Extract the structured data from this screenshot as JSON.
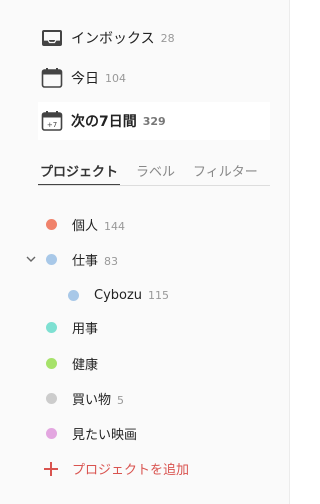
{
  "filters": [
    {
      "label": "インボックス",
      "count": "28",
      "icon": "inbox-icon"
    },
    {
      "label": "今日",
      "count": "104",
      "icon": "calendar-today-icon"
    },
    {
      "label": "次の7日間",
      "count": "329",
      "icon": "calendar-week-icon",
      "icon_text": "+7"
    }
  ],
  "tabs": [
    "プロジェクト",
    "ラベル",
    "フィルター"
  ],
  "projects": [
    {
      "name": "個人",
      "count": "144",
      "color": "#f0826b"
    },
    {
      "name": "仕事",
      "count": "83",
      "color": "#a8c8e8",
      "expanded": true
    },
    {
      "name": "Cybozu",
      "count": "115",
      "color": "#a8c8e8",
      "child": true
    },
    {
      "name": "用事",
      "count": "",
      "color": "#7ee0d2"
    },
    {
      "name": "健康",
      "count": "",
      "color": "#a6e26a"
    },
    {
      "name": "買い物",
      "count": "5",
      "color": "#cccccc"
    },
    {
      "name": "見たい映画",
      "count": "",
      "color": "#e3a6e0"
    }
  ],
  "add_project": {
    "label": "プロジェクトを追加",
    "color": "#d9534f"
  }
}
